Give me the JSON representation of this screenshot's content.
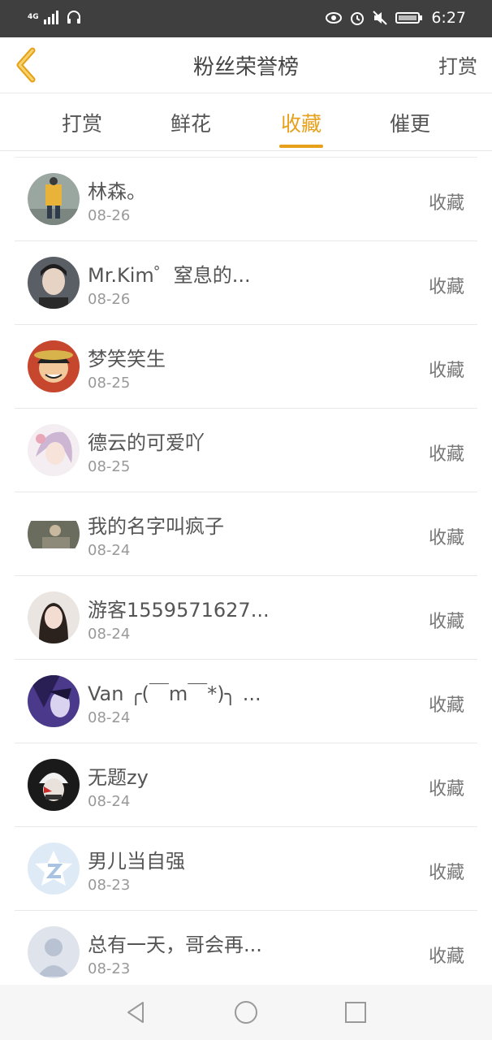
{
  "status_bar": {
    "network": "4G",
    "time": "6:27",
    "icons": [
      "signal-icon",
      "headphone-icon",
      "eye-icon",
      "alarm-icon",
      "mute-icon",
      "battery-icon"
    ]
  },
  "header": {
    "back_icon": "back-chevron-icon",
    "title": "粉丝荣誉榜",
    "action_label": "打赏"
  },
  "tabs": [
    {
      "label": "打赏",
      "active": false
    },
    {
      "label": "鲜花",
      "active": false
    },
    {
      "label": "收藏",
      "active": true
    },
    {
      "label": "催更",
      "active": false
    }
  ],
  "accent_color": "#e7a01a",
  "list": [
    {
      "name": "林森。",
      "date": "08-26",
      "action": "收藏"
    },
    {
      "name": "Mr.Kim゜窒息的...",
      "date": "08-26",
      "action": "收藏"
    },
    {
      "name": "梦笑笑生",
      "date": "08-25",
      "action": "收藏"
    },
    {
      "name": "德云的可爱吖",
      "date": "08-25",
      "action": "收藏"
    },
    {
      "name": "我的名字叫疯子",
      "date": "08-24",
      "action": "收藏"
    },
    {
      "name": "游客1559571627...",
      "date": "08-24",
      "action": "收藏"
    },
    {
      "name": "Van ╭(￣m￣*)╮ ...",
      "date": "08-24",
      "action": "收藏"
    },
    {
      "name": "无题zy",
      "date": "08-24",
      "action": "收藏"
    },
    {
      "name": "男儿当自强",
      "date": "08-23",
      "action": "收藏"
    },
    {
      "name": "总有一天，哥会再...",
      "date": "08-23",
      "action": "收藏"
    }
  ],
  "nav_bar": {
    "icons": [
      "nav-back-icon",
      "nav-home-icon",
      "nav-recents-icon"
    ]
  }
}
